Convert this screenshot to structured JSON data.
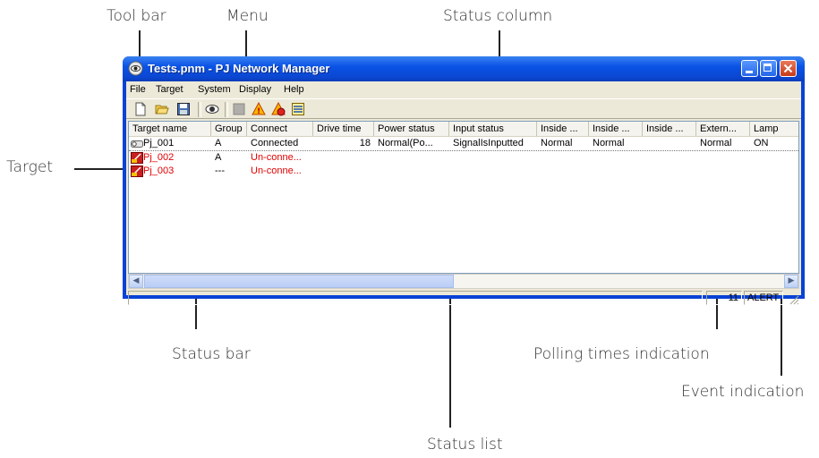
{
  "annotations": {
    "tool_bar": "Tool bar",
    "menu": "Menu",
    "status_column": "Status column",
    "target": "Target",
    "status_bar": "Status bar",
    "polling_times": "Polling times indication",
    "event_indication": "Event indication",
    "status_list": "Status list"
  },
  "window": {
    "title": "Tests.pnm - PJ Network Manager"
  },
  "menu": [
    "File",
    "Target",
    "System",
    "Display",
    "Help"
  ],
  "toolbar": [
    "new-icon",
    "open-icon",
    "save-icon",
    "view-icon",
    "stop-icon",
    "alert-icon",
    "alert-settings-icon",
    "list-icon"
  ],
  "columns": [
    "Target name",
    "Group",
    "Connect",
    "Drive time",
    "Power status",
    "Input status",
    "Inside ...",
    "Inside ...",
    "Inside ...",
    "Extern...",
    "Lamp"
  ],
  "rows": [
    {
      "name": "Pj_001",
      "group": "A",
      "connect": "Connected",
      "drive_time": "18",
      "power": "Normal(Po...",
      "input": "SignalIsInputted",
      "inside1": "Normal",
      "inside2": "Normal",
      "inside3": "",
      "external": "Normal",
      "lamp": "ON",
      "state": "connected"
    },
    {
      "name": "Pj_002",
      "group": "A",
      "connect": "Un-conne...",
      "drive_time": "",
      "power": "",
      "input": "",
      "inside1": "",
      "inside2": "",
      "inside3": "",
      "external": "",
      "lamp": "",
      "state": "error"
    },
    {
      "name": "Pj_003",
      "group": "---",
      "connect": "Un-conne...",
      "drive_time": "",
      "power": "",
      "input": "",
      "inside1": "",
      "inside2": "",
      "inside3": "",
      "external": "",
      "lamp": "",
      "state": "error"
    }
  ],
  "statusbar": {
    "polling_count": "11",
    "event": "ALERT"
  },
  "colors": {
    "title_bar": "#0a53e6",
    "error_text": "#e00000",
    "window_bg": "#ece9d8"
  }
}
